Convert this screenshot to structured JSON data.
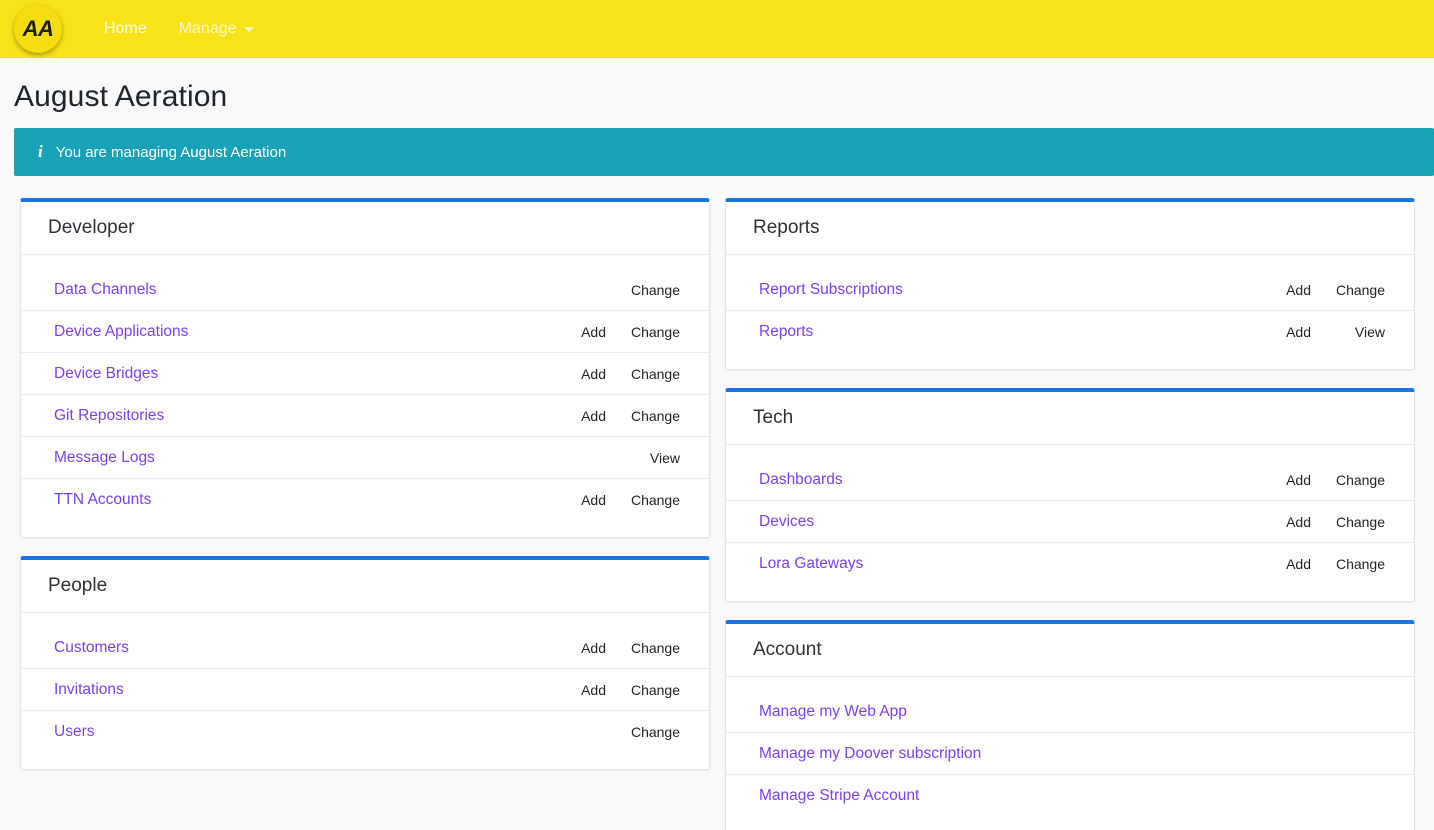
{
  "navbar": {
    "logo_text": "AA",
    "links": [
      {
        "label": "Home",
        "has_caret": false
      },
      {
        "label": "Manage",
        "has_caret": true
      }
    ]
  },
  "page": {
    "title": "August Aeration"
  },
  "alert": {
    "icon": "info-icon",
    "message": "You are managing August Aeration"
  },
  "colors": {
    "navbar_background": "#f7e318",
    "alert_background": "#17a2b8",
    "card_top_border": "#1777e8",
    "link_purple": "#7b3ff2",
    "action_link": "#212529",
    "page_background": "#f8f9fa"
  },
  "left_column": [
    {
      "title": "Developer",
      "rows": [
        {
          "label": "Data Channels",
          "add": "",
          "second": "Change"
        },
        {
          "label": "Device Applications",
          "add": "Add",
          "second": "Change"
        },
        {
          "label": "Device Bridges",
          "add": "Add",
          "second": "Change"
        },
        {
          "label": "Git Repositories",
          "add": "Add",
          "second": "Change"
        },
        {
          "label": "Message Logs",
          "add": "",
          "second": "View"
        },
        {
          "label": "TTN Accounts",
          "add": "Add",
          "second": "Change"
        }
      ]
    },
    {
      "title": "People",
      "rows": [
        {
          "label": "Customers",
          "add": "Add",
          "second": "Change"
        },
        {
          "label": "Invitations",
          "add": "Add",
          "second": "Change"
        },
        {
          "label": "Users",
          "add": "",
          "second": "Change"
        }
      ]
    }
  ],
  "right_column": [
    {
      "title": "Reports",
      "rows": [
        {
          "label": "Report Subscriptions",
          "add": "Add",
          "second": "Change"
        },
        {
          "label": "Reports",
          "add": "Add",
          "second": "View"
        }
      ]
    },
    {
      "title": "Tech",
      "rows": [
        {
          "label": "Dashboards",
          "add": "Add",
          "second": "Change"
        },
        {
          "label": "Devices",
          "add": "Add",
          "second": "Change"
        },
        {
          "label": "Lora Gateways",
          "add": "Add",
          "second": "Change"
        }
      ]
    },
    {
      "title": "Account",
      "rows": [
        {
          "label": "Manage my Web App",
          "add": "",
          "second": ""
        },
        {
          "label": "Manage my Doover subscription",
          "add": "",
          "second": ""
        },
        {
          "label": "Manage Stripe Account",
          "add": "",
          "second": ""
        }
      ]
    }
  ]
}
